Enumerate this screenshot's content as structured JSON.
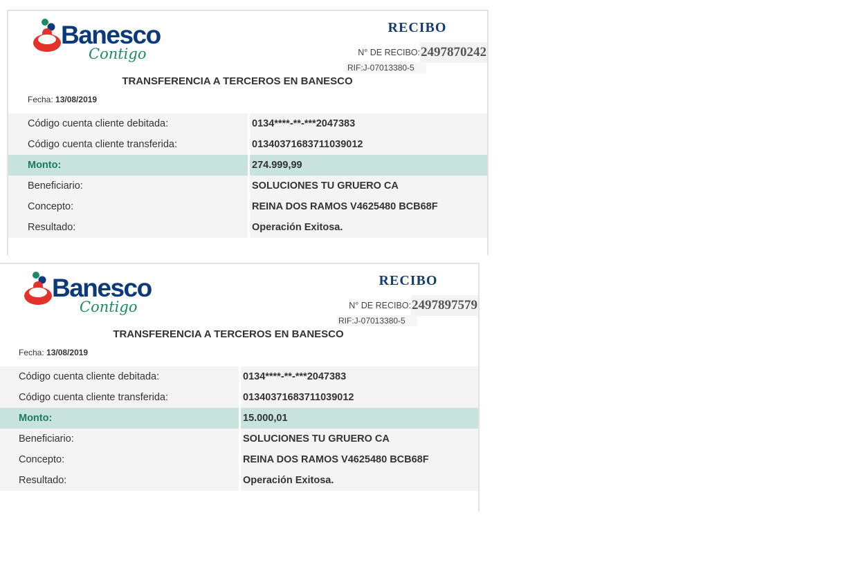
{
  "brand": {
    "name": "Banesco",
    "tagline": "Contigo"
  },
  "receipts": [
    {
      "title": "RECIBO",
      "receipt_label": "N° DE RECIBO:",
      "receipt_number": "2497870242",
      "rif": "RIF:J-07013380-5",
      "doc_title": "TRANSFERENCIA A TERCEROS EN BANESCO",
      "date_label": "Fecha:",
      "date": "13/08/2019",
      "rows": [
        {
          "label": "Código cuenta cliente debitada:",
          "value": "0134****-**-***2047383"
        },
        {
          "label": "Código cuenta cliente transferida:",
          "value": "01340371683711039012"
        },
        {
          "label": "Monto:",
          "value": "274.999,99"
        },
        {
          "label": "Beneficiario:",
          "value": "SOLUCIONES TU GRUERO CA"
        },
        {
          "label": "Concepto:",
          "value": "REINA DOS RAMOS V4625480 BCB68F"
        },
        {
          "label": "Resultado:",
          "value": "Operación Exitosa."
        }
      ]
    },
    {
      "title": "RECIBO",
      "receipt_label": "N° DE RECIBO:",
      "receipt_number": "2497897579",
      "rif": "RIF:J-07013380-5",
      "doc_title": "TRANSFERENCIA A TERCEROS EN BANESCO",
      "date_label": "Fecha:",
      "date": "13/08/2019",
      "rows": [
        {
          "label": "Código cuenta cliente debitada:",
          "value": "0134****-**-***2047383"
        },
        {
          "label": "Código cuenta cliente transferida:",
          "value": "01340371683711039012"
        },
        {
          "label": "Monto:",
          "value": "15.000,01"
        },
        {
          "label": "Beneficiario:",
          "value": "SOLUCIONES TU GRUERO CA"
        },
        {
          "label": "Concepto:",
          "value": "REINA DOS RAMOS V4625480 BCB68F"
        },
        {
          "label": "Resultado:",
          "value": "Operación Exitosa."
        }
      ]
    }
  ],
  "colors": {
    "brand_blue": "#0b3a7a",
    "brand_green": "#1d8a66",
    "logo_red": "#e2322b",
    "highlight": "#c8e2dc"
  }
}
